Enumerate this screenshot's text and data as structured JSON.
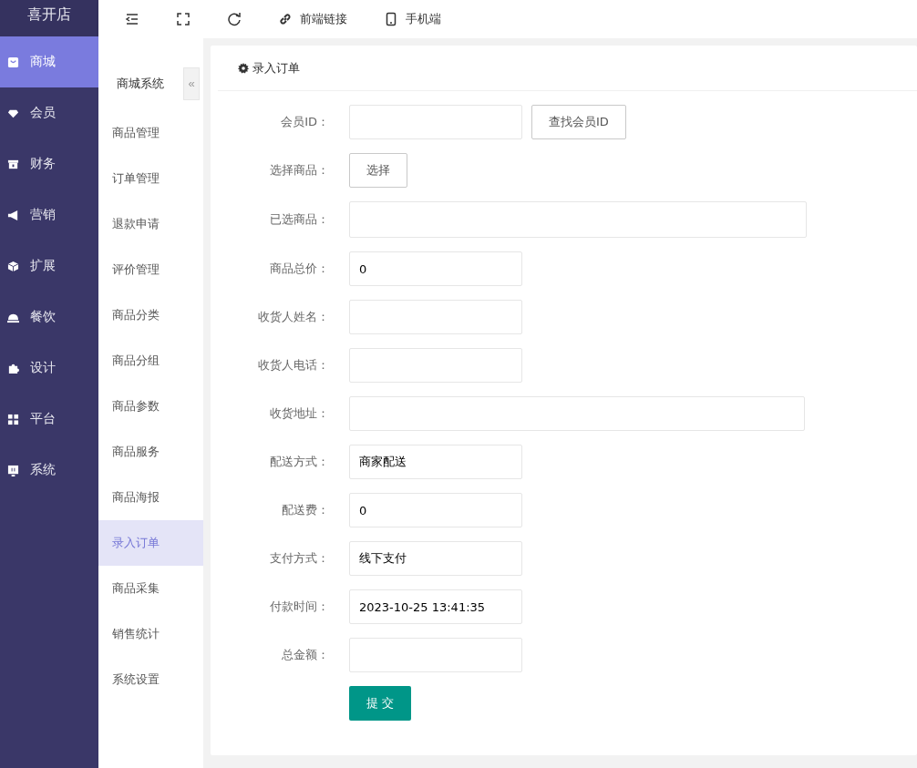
{
  "logo": "喜开店",
  "toolbar": [
    {
      "kind": "collapse"
    },
    {
      "kind": "fullscreen"
    },
    {
      "kind": "refresh"
    },
    {
      "kind": "link",
      "label": "前端链接"
    },
    {
      "kind": "mobile",
      "label": "手机端"
    }
  ],
  "main_nav": [
    {
      "label": "商城",
      "selected": true
    },
    {
      "label": "会员",
      "selected": false
    },
    {
      "label": "财务",
      "selected": false
    },
    {
      "label": "营销",
      "selected": false
    },
    {
      "label": "扩展",
      "selected": false
    },
    {
      "label": "餐饮",
      "selected": false
    },
    {
      "label": "设计",
      "selected": false
    },
    {
      "label": "平台",
      "selected": false
    },
    {
      "label": "系统",
      "selected": false
    }
  ],
  "sub_nav": {
    "title": "商城系统",
    "collapse_glyph": "«",
    "items": [
      {
        "label": "商品管理",
        "selected": false
      },
      {
        "label": "订单管理",
        "selected": false
      },
      {
        "label": "退款申请",
        "selected": false
      },
      {
        "label": "评价管理",
        "selected": false
      },
      {
        "label": "商品分类",
        "selected": false
      },
      {
        "label": "商品分组",
        "selected": false
      },
      {
        "label": "商品参数",
        "selected": false
      },
      {
        "label": "商品服务",
        "selected": false
      },
      {
        "label": "商品海报",
        "selected": false
      },
      {
        "label": "录入订单",
        "selected": true
      },
      {
        "label": "商品采集",
        "selected": false
      },
      {
        "label": "销售统计",
        "selected": false
      },
      {
        "label": "系统设置",
        "selected": false
      }
    ]
  },
  "card": {
    "title": "录入订单",
    "fields": [
      {
        "kind": "input_button",
        "label": "会员ID：",
        "button": "查找会员ID"
      },
      {
        "kind": "button",
        "label": "选择商品：",
        "button": "选择"
      },
      {
        "kind": "area",
        "label": "已选商品："
      },
      {
        "kind": "input",
        "label": "商品总价：",
        "value": "0"
      },
      {
        "kind": "input",
        "label": "收货人姓名："
      },
      {
        "kind": "input",
        "label": "收货人电话："
      },
      {
        "kind": "wide",
        "label": "收货地址："
      },
      {
        "kind": "input",
        "label": "配送方式：",
        "value": "商家配送"
      },
      {
        "kind": "input",
        "label": "配送费：",
        "value": "0"
      },
      {
        "kind": "input",
        "label": "支付方式：",
        "value": "线下支付"
      },
      {
        "kind": "input",
        "label": "付款时间：",
        "value": "2023-10-25 13:41:35"
      },
      {
        "kind": "input",
        "label": "总金额："
      }
    ],
    "submit": "提 交"
  }
}
